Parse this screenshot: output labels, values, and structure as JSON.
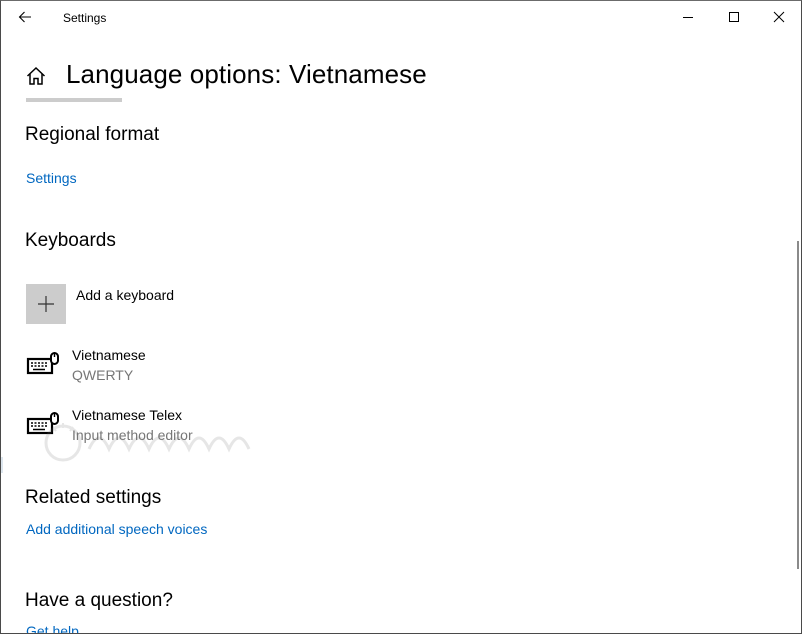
{
  "window": {
    "title": "Settings",
    "controls": {
      "minimize": "minimize-icon",
      "maximize": "maximize-icon",
      "close": "close-icon"
    }
  },
  "header": {
    "title": "Language options: Vietnamese",
    "icon": "home-icon"
  },
  "regional_format": {
    "title": "Regional format",
    "link": "Settings"
  },
  "keyboards": {
    "title": "Keyboards",
    "add_label": "Add a keyboard",
    "items": [
      {
        "name": "Vietnamese",
        "subtitle": "QWERTY",
        "icon": "keyboard-icon"
      },
      {
        "name": "Vietnamese Telex",
        "subtitle": "Input method editor",
        "icon": "keyboard-icon"
      }
    ]
  },
  "related_settings": {
    "title": "Related settings",
    "link": "Add additional speech voices"
  },
  "help": {
    "title": "Have a question?",
    "link": "Get help"
  },
  "colors": {
    "link": "#0067c0",
    "subtitle": "#767676",
    "tile": "#cccccc"
  }
}
